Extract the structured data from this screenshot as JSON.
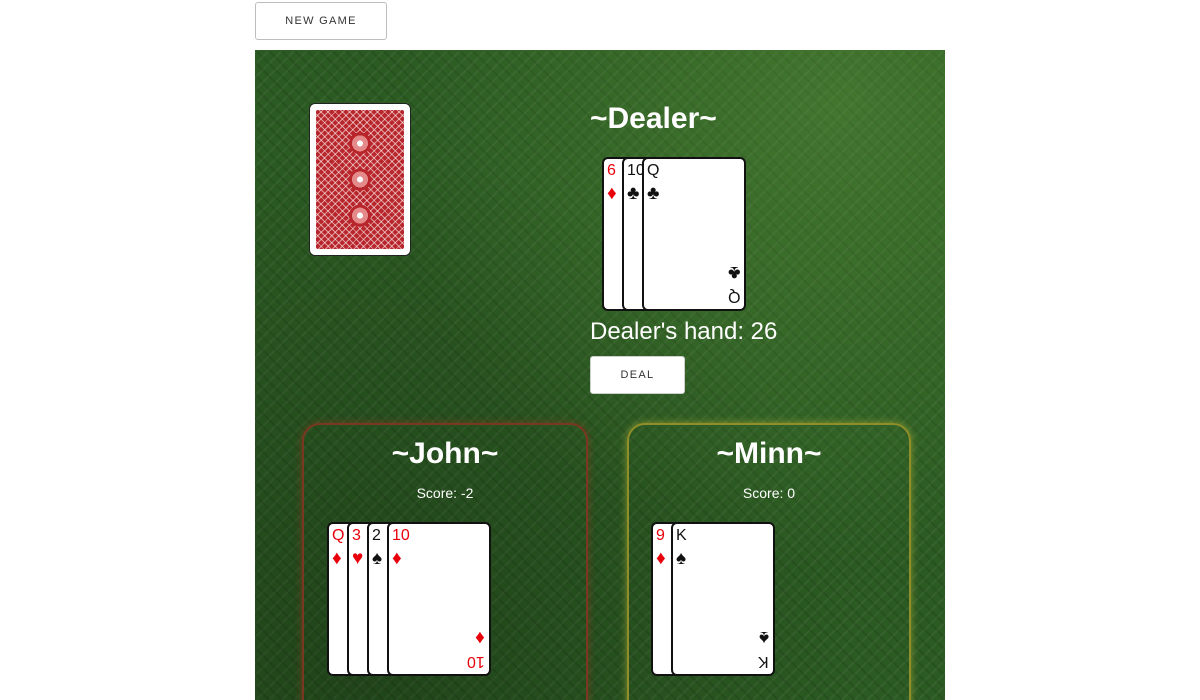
{
  "toolbar": {
    "new_game_label": "NEW GAME"
  },
  "deck": {
    "icon": "card-back-pattern",
    "back_color": "#b8262b"
  },
  "dealer": {
    "name": "~Dealer~",
    "hand_label": "Dealer's hand: 26",
    "deal_label": "DEAL",
    "cards": [
      {
        "rank": "6",
        "suit": "♦",
        "color": "red"
      },
      {
        "rank": "10",
        "suit": "♣",
        "color": "black"
      },
      {
        "rank": "Q",
        "suit": "♣",
        "color": "black"
      }
    ]
  },
  "players": [
    {
      "name": "~John~",
      "score": "Score: -2",
      "cards": [
        {
          "rank": "Q",
          "suit": "♦",
          "color": "red"
        },
        {
          "rank": "3",
          "suit": "♥",
          "color": "red"
        },
        {
          "rank": "2",
          "suit": "♠",
          "color": "black"
        },
        {
          "rank": "10",
          "suit": "♦",
          "color": "red"
        }
      ]
    },
    {
      "name": "~Minn~",
      "score": "Score: 0",
      "cards": [
        {
          "rank": "9",
          "suit": "♦",
          "color": "red"
        },
        {
          "rank": "K",
          "suit": "♠",
          "color": "black"
        }
      ]
    }
  ],
  "colors": {
    "felt": "#2b5a22",
    "red_suit": "#e8000b",
    "black_suit": "#111111"
  }
}
